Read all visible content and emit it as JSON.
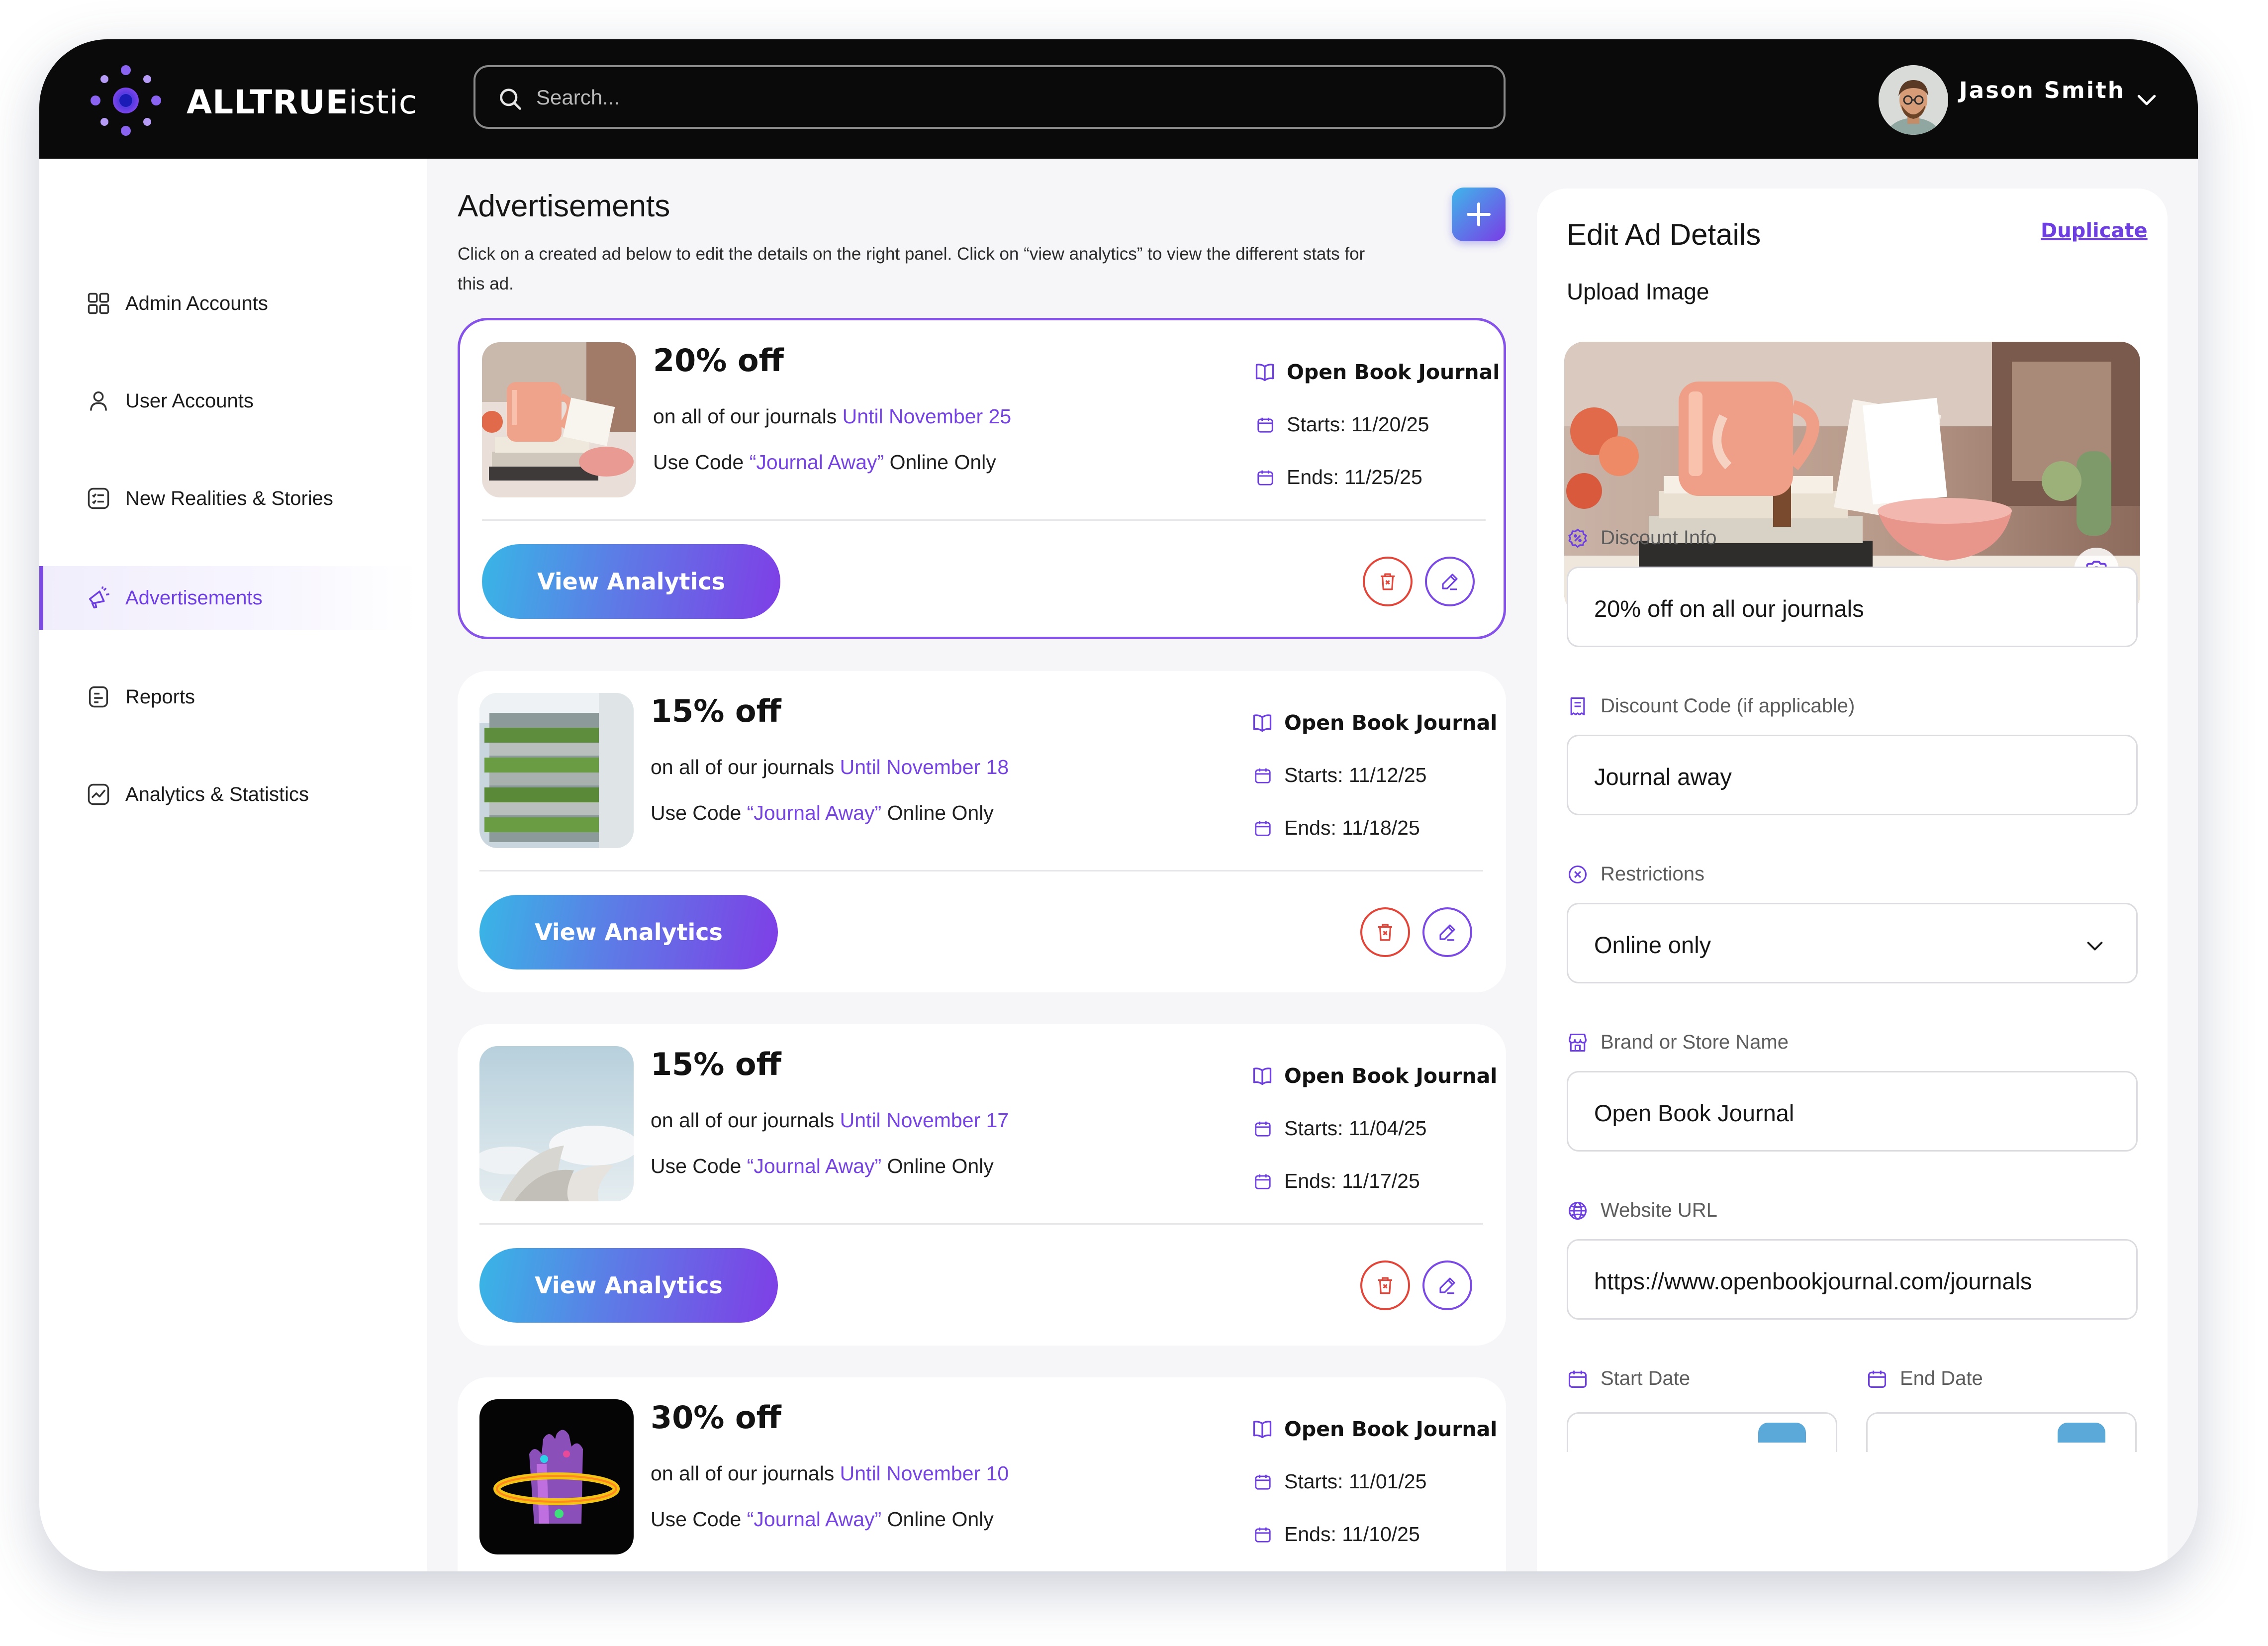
{
  "app": {
    "brand_bold": "ALLTRUE",
    "brand_light": "istic",
    "accent_color": "#7b4ae3",
    "danger_color": "#e0463a"
  },
  "search": {
    "placeholder": "Search..."
  },
  "user": {
    "name": "Jason Smith",
    "menu_icon": "chevron-down-icon"
  },
  "sidebar": {
    "items": [
      {
        "label": "Admin Accounts",
        "icon": "grid-icon",
        "active": false
      },
      {
        "label": "User Accounts",
        "icon": "user-icon",
        "active": false
      },
      {
        "label": "New Realities & Stories",
        "icon": "list-icon",
        "active": false
      },
      {
        "label": "Advertisements",
        "icon": "megaphone-icon",
        "active": true
      },
      {
        "label": "Reports",
        "icon": "report-icon",
        "active": false
      },
      {
        "label": "Analytics & Statistics",
        "icon": "chart-icon",
        "active": false
      }
    ]
  },
  "main": {
    "title": "Advertisements",
    "description": "Click on a created ad below to edit the details on the right panel. Click on “view analytics” to view the different stats for this ad.",
    "add_icon": "plus-icon",
    "ads": [
      {
        "title": "20% off",
        "line1_prefix": "on all of our journals",
        "until": "Until November 25",
        "code_prefix": "Use Code",
        "code": "“Journal Away”",
        "code_suffix": "Online Only",
        "brand": "Open Book Journal",
        "starts": "Starts: 11/20/25",
        "ends": "Ends: 11/25/25",
        "button": "View Analytics",
        "selected": true
      },
      {
        "title": "15% off",
        "line1_prefix": "on all of our journals",
        "until": "Until November 18",
        "code_prefix": "Use Code",
        "code": "“Journal Away”",
        "code_suffix": "Online Only",
        "brand": "Open Book Journal",
        "starts": "Starts: 11/12/25",
        "ends": "Ends: 11/18/25",
        "button": "View Analytics",
        "selected": false
      },
      {
        "title": "15% off",
        "line1_prefix": "on all of our journals",
        "until": "Until November 17",
        "code_prefix": "Use Code",
        "code": "“Journal Away”",
        "code_suffix": "Online Only",
        "brand": "Open Book Journal",
        "starts": "Starts: 11/04/25",
        "ends": "Ends: 11/17/25",
        "button": "View Analytics",
        "selected": false
      },
      {
        "title": "30% off",
        "line1_prefix": "on all of our journals",
        "until": "Until November 10",
        "code_prefix": "Use Code",
        "code": "“Journal Away”",
        "code_suffix": "Online Only",
        "brand": "Open Book Journal",
        "starts": "Starts: 11/01/25",
        "ends": "Ends: 11/10/25",
        "button": "View Analytics",
        "selected": false
      }
    ]
  },
  "panel": {
    "title": "Edit Ad Details",
    "duplicate": "Duplicate",
    "upload_label": "Upload Image",
    "fields": {
      "discount_info": {
        "label": "Discount Info",
        "value": "20% off on all our journals"
      },
      "discount_code": {
        "label": "Discount Code (if applicable)",
        "value": "Journal away"
      },
      "restrictions": {
        "label": "Restrictions",
        "value": "Online only"
      },
      "brand": {
        "label": "Brand or Store Name",
        "value": "Open Book Journal"
      },
      "website": {
        "label": "Website URL",
        "value": "https://www.openbookjournal.com/journals"
      },
      "start_date": {
        "label": "Start Date"
      },
      "end_date": {
        "label": "End Date"
      }
    }
  }
}
